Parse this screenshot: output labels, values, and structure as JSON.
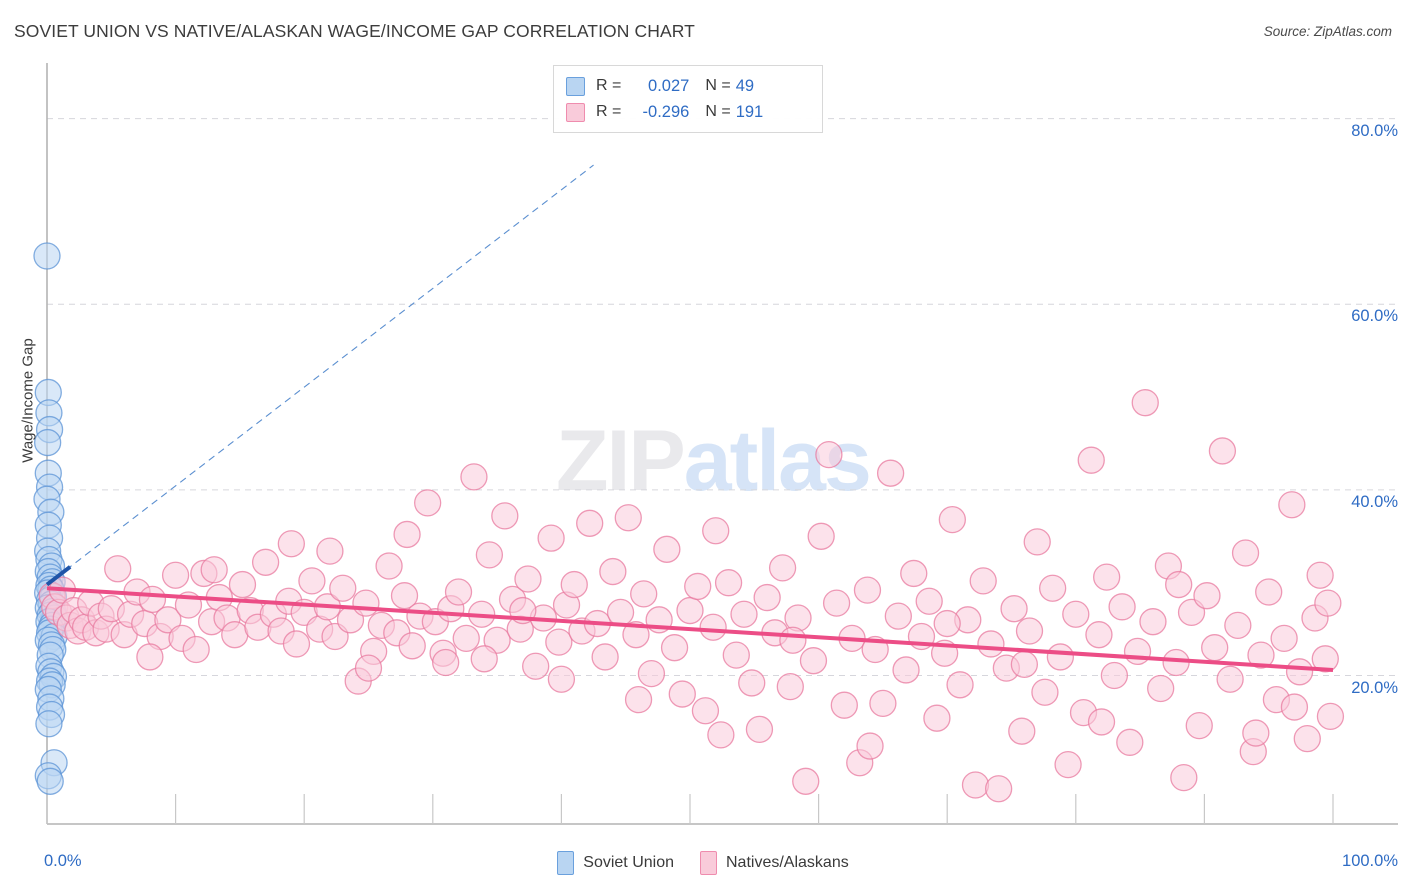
{
  "header": {
    "title": "SOVIET UNION VS NATIVE/ALASKAN WAGE/INCOME GAP CORRELATION CHART",
    "source": "Source: ZipAtlas.com"
  },
  "watermark": {
    "part1": "ZIP",
    "part2": "atlas"
  },
  "axes": {
    "ylabel": "Wage/Income Gap",
    "y_ticks": [
      "80.0%",
      "60.0%",
      "40.0%",
      "20.0%"
    ],
    "x_min_label": "0.0%",
    "x_max_label": "100.0%"
  },
  "correlation": {
    "rows": [
      {
        "color": "#b9d5f2",
        "r_label": "R =",
        "r_value": "0.027",
        "n_label": "N =",
        "n_value": "49"
      },
      {
        "color": "#f9cbda",
        "r_label": "R =",
        "r_value": "-0.296",
        "n_label": "N =",
        "n_value": "191"
      }
    ]
  },
  "legend": {
    "items": [
      {
        "label": "Soviet Union",
        "color": "#b9d5f2"
      },
      {
        "label": "Natives/Alaskans",
        "color": "#f9cbda"
      }
    ]
  },
  "chart_data": {
    "type": "scatter",
    "title": "SOVIET UNION VS NATIVE/ALASKAN WAGE/INCOME GAP CORRELATION CHART",
    "xlabel": "",
    "ylabel": "Wage/Income Gap",
    "xlim": [
      0,
      100
    ],
    "ylim": [
      4.0,
      86.0
    ],
    "x_tick_values": [
      0,
      10,
      20,
      30,
      40,
      50,
      60,
      70,
      80,
      90,
      100
    ],
    "y_tick_values": [
      20,
      40,
      60,
      80
    ],
    "grid": true,
    "legend_position": "bottom-center",
    "series": [
      {
        "name": "Soviet Union",
        "color": "#b9d5f2",
        "stroke": "#5b93d6",
        "r": 0.027,
        "n": 49,
        "trend": {
          "style": "dashed-extended",
          "x0": 0,
          "y0": 29.8,
          "x1": 42.5,
          "y1": 75.0,
          "solid_to_x": 1.8
        },
        "points": [
          [
            0.0,
            65.2
          ],
          [
            0.1,
            50.5
          ],
          [
            0.15,
            48.3
          ],
          [
            0.2,
            46.5
          ],
          [
            0.05,
            45.1
          ],
          [
            0.1,
            41.8
          ],
          [
            0.2,
            40.3
          ],
          [
            0.0,
            39.0
          ],
          [
            0.3,
            37.6
          ],
          [
            0.1,
            36.2
          ],
          [
            0.2,
            34.8
          ],
          [
            0.05,
            33.4
          ],
          [
            0.15,
            32.5
          ],
          [
            0.35,
            31.8
          ],
          [
            0.1,
            31.2
          ],
          [
            0.25,
            30.6
          ],
          [
            0.4,
            30.1
          ],
          [
            0.15,
            29.7
          ],
          [
            0.3,
            29.3
          ],
          [
            0.05,
            28.9
          ],
          [
            0.5,
            28.5
          ],
          [
            0.2,
            28.1
          ],
          [
            0.35,
            27.7
          ],
          [
            0.1,
            27.3
          ],
          [
            0.45,
            26.9
          ],
          [
            0.25,
            26.5
          ],
          [
            0.6,
            26.2
          ],
          [
            0.15,
            25.8
          ],
          [
            0.4,
            25.4
          ],
          [
            0.3,
            25.0
          ],
          [
            0.2,
            24.6
          ],
          [
            0.55,
            24.2
          ],
          [
            0.1,
            23.8
          ],
          [
            0.35,
            23.3
          ],
          [
            0.45,
            22.8
          ],
          [
            0.25,
            22.2
          ],
          [
            0.15,
            21.0
          ],
          [
            0.3,
            20.4
          ],
          [
            0.5,
            19.9
          ],
          [
            0.2,
            19.4
          ],
          [
            0.4,
            19.0
          ],
          [
            0.1,
            18.5
          ],
          [
            0.3,
            17.5
          ],
          [
            0.2,
            16.6
          ],
          [
            0.35,
            15.8
          ],
          [
            0.15,
            14.8
          ],
          [
            0.55,
            10.6
          ],
          [
            0.1,
            9.2
          ],
          [
            0.25,
            8.6
          ]
        ]
      },
      {
        "name": "Natives/Alaskans",
        "color": "#f9cbda",
        "stroke": "#e8799f",
        "r": -0.296,
        "n": 191,
        "trend": {
          "style": "solid",
          "x0": 0,
          "y0": 29.4,
          "x1": 100,
          "y1": 20.6
        },
        "points": [
          [
            0.4,
            28.6
          ],
          [
            0.6,
            27.4
          ],
          [
            0.9,
            26.8
          ],
          [
            1.2,
            29.2
          ],
          [
            1.5,
            26.2
          ],
          [
            1.8,
            25.4
          ],
          [
            2.1,
            27.0
          ],
          [
            2.4,
            24.8
          ],
          [
            2.7,
            26.0
          ],
          [
            3.0,
            25.2
          ],
          [
            3.4,
            27.8
          ],
          [
            3.8,
            24.6
          ],
          [
            4.2,
            26.4
          ],
          [
            4.6,
            25.0
          ],
          [
            5.0,
            27.2
          ],
          [
            5.5,
            31.5
          ],
          [
            6.0,
            24.4
          ],
          [
            6.5,
            26.6
          ],
          [
            7.0,
            29.0
          ],
          [
            7.6,
            25.6
          ],
          [
            8.2,
            28.2
          ],
          [
            8.8,
            24.2
          ],
          [
            9.4,
            26.0
          ],
          [
            10.0,
            30.8
          ],
          [
            10.5,
            24.0
          ],
          [
            11.0,
            27.6
          ],
          [
            11.6,
            22.8
          ],
          [
            12.2,
            31.0
          ],
          [
            12.8,
            25.8
          ],
          [
            13.4,
            28.4
          ],
          [
            14.0,
            26.2
          ],
          [
            14.6,
            24.4
          ],
          [
            15.2,
            29.8
          ],
          [
            15.8,
            27.0
          ],
          [
            16.4,
            25.2
          ],
          [
            17.0,
            32.2
          ],
          [
            17.6,
            26.6
          ],
          [
            18.2,
            24.8
          ],
          [
            18.8,
            28.0
          ],
          [
            19.4,
            23.4
          ],
          [
            20.0,
            26.8
          ],
          [
            20.6,
            30.2
          ],
          [
            21.2,
            25.0
          ],
          [
            21.8,
            27.4
          ],
          [
            22.4,
            24.2
          ],
          [
            23.0,
            29.4
          ],
          [
            23.6,
            26.0
          ],
          [
            24.2,
            19.4
          ],
          [
            24.8,
            27.8
          ],
          [
            25.4,
            22.6
          ],
          [
            26.0,
            25.4
          ],
          [
            26.6,
            31.8
          ],
          [
            27.2,
            24.6
          ],
          [
            27.8,
            28.6
          ],
          [
            28.4,
            23.2
          ],
          [
            29.0,
            26.4
          ],
          [
            29.6,
            38.6
          ],
          [
            30.2,
            25.8
          ],
          [
            30.8,
            22.4
          ],
          [
            31.4,
            27.2
          ],
          [
            32.0,
            29.0
          ],
          [
            32.6,
            24.0
          ],
          [
            33.2,
            41.4
          ],
          [
            33.8,
            26.6
          ],
          [
            34.4,
            33.0
          ],
          [
            35.0,
            23.8
          ],
          [
            35.6,
            37.2
          ],
          [
            36.2,
            28.2
          ],
          [
            36.8,
            25.0
          ],
          [
            37.4,
            30.4
          ],
          [
            38.0,
            21.0
          ],
          [
            38.6,
            26.2
          ],
          [
            39.2,
            34.8
          ],
          [
            39.8,
            23.6
          ],
          [
            40.4,
            27.6
          ],
          [
            41.0,
            29.8
          ],
          [
            41.6,
            24.8
          ],
          [
            42.2,
            36.4
          ],
          [
            42.8,
            25.6
          ],
          [
            43.4,
            22.0
          ],
          [
            44.0,
            31.2
          ],
          [
            44.6,
            26.8
          ],
          [
            45.2,
            37.0
          ],
          [
            45.8,
            24.4
          ],
          [
            46.4,
            28.8
          ],
          [
            47.0,
            20.2
          ],
          [
            47.6,
            26.0
          ],
          [
            48.2,
            33.6
          ],
          [
            48.8,
            23.0
          ],
          [
            49.4,
            18.0
          ],
          [
            50.0,
            27.0
          ],
          [
            50.6,
            29.6
          ],
          [
            51.2,
            16.2
          ],
          [
            51.8,
            25.2
          ],
          [
            52.4,
            13.6
          ],
          [
            53.0,
            30.0
          ],
          [
            53.6,
            22.2
          ],
          [
            54.2,
            26.6
          ],
          [
            54.8,
            19.2
          ],
          [
            55.4,
            14.2
          ],
          [
            56.0,
            28.4
          ],
          [
            56.6,
            24.6
          ],
          [
            57.2,
            31.6
          ],
          [
            57.8,
            18.8
          ],
          [
            58.4,
            26.2
          ],
          [
            59.0,
            8.6
          ],
          [
            59.6,
            21.6
          ],
          [
            60.2,
            35.0
          ],
          [
            60.8,
            43.8
          ],
          [
            61.4,
            27.8
          ],
          [
            62.0,
            16.8
          ],
          [
            62.6,
            24.0
          ],
          [
            63.2,
            10.6
          ],
          [
            63.8,
            29.2
          ],
          [
            64.4,
            22.8
          ],
          [
            65.0,
            17.0
          ],
          [
            65.6,
            41.8
          ],
          [
            66.2,
            26.4
          ],
          [
            66.8,
            20.6
          ],
          [
            67.4,
            31.0
          ],
          [
            68.0,
            24.2
          ],
          [
            68.6,
            28.0
          ],
          [
            69.2,
            15.4
          ],
          [
            69.8,
            22.4
          ],
          [
            70.4,
            36.8
          ],
          [
            71.0,
            19.0
          ],
          [
            71.6,
            26.0
          ],
          [
            72.2,
            8.2
          ],
          [
            72.8,
            30.2
          ],
          [
            73.4,
            23.4
          ],
          [
            74.0,
            7.8
          ],
          [
            74.6,
            20.8
          ],
          [
            75.2,
            27.2
          ],
          [
            75.8,
            14.0
          ],
          [
            76.4,
            24.8
          ],
          [
            77.0,
            34.4
          ],
          [
            77.6,
            18.2
          ],
          [
            78.2,
            29.4
          ],
          [
            78.8,
            22.0
          ],
          [
            79.4,
            10.4
          ],
          [
            80.0,
            26.6
          ],
          [
            80.6,
            16.0
          ],
          [
            81.2,
            43.2
          ],
          [
            81.8,
            24.4
          ],
          [
            82.4,
            30.6
          ],
          [
            83.0,
            20.0
          ],
          [
            83.6,
            27.4
          ],
          [
            84.2,
            12.8
          ],
          [
            84.8,
            22.6
          ],
          [
            85.4,
            49.4
          ],
          [
            86.0,
            25.8
          ],
          [
            86.6,
            18.6
          ],
          [
            87.2,
            31.8
          ],
          [
            87.8,
            21.4
          ],
          [
            88.4,
            9.0
          ],
          [
            89.0,
            26.8
          ],
          [
            89.6,
            14.6
          ],
          [
            90.2,
            28.6
          ],
          [
            90.8,
            23.0
          ],
          [
            91.4,
            44.2
          ],
          [
            92.0,
            19.6
          ],
          [
            92.6,
            25.4
          ],
          [
            93.2,
            33.2
          ],
          [
            93.8,
            11.8
          ],
          [
            94.4,
            22.2
          ],
          [
            95.0,
            29.0
          ],
          [
            95.6,
            17.4
          ],
          [
            96.2,
            24.0
          ],
          [
            96.8,
            38.4
          ],
          [
            97.4,
            20.4
          ],
          [
            98.0,
            13.2
          ],
          [
            98.6,
            26.2
          ],
          [
            99.0,
            30.8
          ],
          [
            99.4,
            21.8
          ],
          [
            99.8,
            15.6
          ],
          [
            22.0,
            33.4
          ],
          [
            28.0,
            35.2
          ],
          [
            34.0,
            21.8
          ],
          [
            40.0,
            19.6
          ],
          [
            46.0,
            17.4
          ],
          [
            52.0,
            35.6
          ],
          [
            58.0,
            23.8
          ],
          [
            64.0,
            12.4
          ],
          [
            70.0,
            25.6
          ],
          [
            76.0,
            21.2
          ],
          [
            82.0,
            15.0
          ],
          [
            88.0,
            29.8
          ],
          [
            94.0,
            13.8
          ],
          [
            97.0,
            16.6
          ],
          [
            99.6,
            27.8
          ],
          [
            8.0,
            22.0
          ],
          [
            13.0,
            31.4
          ],
          [
            19.0,
            34.2
          ],
          [
            25.0,
            20.8
          ],
          [
            31.0,
            21.4
          ],
          [
            37.0,
            27.0
          ]
        ]
      }
    ]
  }
}
